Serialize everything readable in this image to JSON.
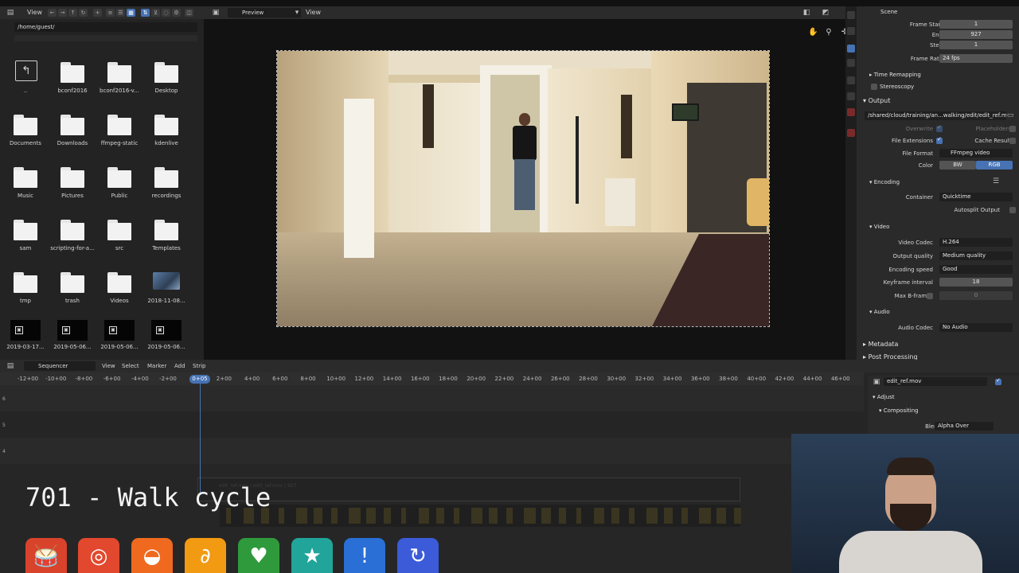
{
  "file_browser": {
    "view_menu": "View",
    "path": "/home/guest/",
    "items": [
      {
        "label": "..",
        "kind": "parent"
      },
      {
        "label": "bconf2016",
        "kind": "folder"
      },
      {
        "label": "bconf2016-v...",
        "kind": "folder"
      },
      {
        "label": "Desktop",
        "kind": "folder"
      },
      {
        "label": "Documents",
        "kind": "folder"
      },
      {
        "label": "Downloads",
        "kind": "folder"
      },
      {
        "label": "ffmpeg-static",
        "kind": "folder"
      },
      {
        "label": "kdenlive",
        "kind": "folder"
      },
      {
        "label": "Music",
        "kind": "folder"
      },
      {
        "label": "Pictures",
        "kind": "folder"
      },
      {
        "label": "Public",
        "kind": "folder"
      },
      {
        "label": "recordings",
        "kind": "folder"
      },
      {
        "label": "sam",
        "kind": "folder"
      },
      {
        "label": "scripting-for-a...",
        "kind": "folder"
      },
      {
        "label": "src",
        "kind": "folder"
      },
      {
        "label": "Templates",
        "kind": "folder"
      },
      {
        "label": "tmp",
        "kind": "folder"
      },
      {
        "label": "trash",
        "kind": "folder"
      },
      {
        "label": "Videos",
        "kind": "folder"
      },
      {
        "label": "2018-11-08...",
        "kind": "image"
      },
      {
        "label": "2019-03-17...",
        "kind": "video"
      },
      {
        "label": "2019-05-06...",
        "kind": "video"
      },
      {
        "label": "2019-05-06...",
        "kind": "video"
      },
      {
        "label": "2019-05-06...",
        "kind": "video"
      }
    ]
  },
  "preview": {
    "display_mode": "Preview",
    "view_menu": "View"
  },
  "properties": {
    "scene_tab": "Scene",
    "frame_start_label": "Frame Start",
    "frame_start": "1",
    "end_label": "End",
    "end": "927",
    "step_label": "Step",
    "step": "1",
    "frame_rate_label": "Frame Rate",
    "frame_rate": "24 fps",
    "time_remapping": "Time Remapping",
    "stereoscopy": "Stereoscopy",
    "output_section": "Output",
    "output_path": "/shared/cloud/training/an...walking/edit/edit_ref.mov",
    "overwrite_label": "Overwrite",
    "placeholders_label": "Placeholders",
    "file_extensions_label": "File Extensions",
    "cache_result_label": "Cache Result",
    "file_format_label": "File Format",
    "file_format": "FFmpeg video",
    "color_label": "Color",
    "color_bw": "BW",
    "color_rgb": "RGB",
    "encoding_section": "Encoding",
    "container_label": "Container",
    "container": "Quicktime",
    "autosplit_label": "Autosplit Output",
    "video_section": "Video",
    "video_codec_label": "Video Codec",
    "video_codec": "H.264",
    "output_quality_label": "Output quality",
    "output_quality": "Medium quality",
    "encoding_speed_label": "Encoding speed",
    "encoding_speed": "Good",
    "keyframe_interval_label": "Keyframe interval",
    "keyframe_interval": "18",
    "max_bframes_label": "Max B-frames",
    "max_bframes": "0",
    "audio_section": "Audio",
    "audio_codec_label": "Audio Codec",
    "audio_codec": "No Audio",
    "metadata_section": "Metadata",
    "post_processing_section": "Post Processing"
  },
  "sequencer": {
    "editor_type": "Sequencer",
    "menus": [
      "View",
      "Select",
      "Marker",
      "Add",
      "Strip"
    ],
    "ticks": [
      "-12+00",
      "-10+00",
      "-8+00",
      "-6+00",
      "-4+00",
      "-2+00",
      "0+05",
      "2+00",
      "4+00",
      "6+00",
      "8+00",
      "10+00",
      "12+00",
      "14+00",
      "16+00",
      "18+00",
      "20+00",
      "22+00",
      "24+00",
      "26+00",
      "28+00",
      "30+00",
      "32+00",
      "34+00",
      "36+00",
      "38+00",
      "40+00",
      "42+00",
      "44+00",
      "46+00"
    ],
    "current_time": "0+05",
    "channels": [
      "6",
      "5",
      "4"
    ],
    "strip_label": "edit_ref.mov | edit_ref.mov | 927",
    "active_strip_name": "edit_ref.mov",
    "adjust_section": "Adjust",
    "compositing_section": "Compositing",
    "blend_label": "Blend",
    "blend_value": "Alpha Over"
  },
  "overlay": {
    "title": "701 - Walk cycle"
  }
}
